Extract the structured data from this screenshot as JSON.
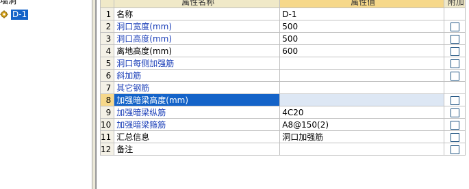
{
  "tree": {
    "root_label": "墙洞",
    "item_label": "D-1"
  },
  "grid": {
    "headers": {
      "name": "属性名称",
      "value": "属性值",
      "extra": "附加"
    },
    "rows": [
      {
        "n": "1",
        "name": "名称",
        "value": "D-1",
        "check": false,
        "blue": false
      },
      {
        "n": "2",
        "name": "洞口宽度(mm)",
        "value": "500",
        "check": true,
        "blue": true
      },
      {
        "n": "3",
        "name": "洞口高度(mm)",
        "value": "500",
        "check": true,
        "blue": true
      },
      {
        "n": "4",
        "name": "离地高度(mm)",
        "value": "600",
        "check": true,
        "blue": false
      },
      {
        "n": "5",
        "name": "洞口每侧加强筋",
        "value": "",
        "check": true,
        "blue": true
      },
      {
        "n": "6",
        "name": "斜加筋",
        "value": "",
        "check": true,
        "blue": true
      },
      {
        "n": "7",
        "name": "其它钢筋",
        "value": "",
        "check": false,
        "blue": true
      },
      {
        "n": "8",
        "name": "加强暗梁高度(mm)",
        "value": "",
        "check": true,
        "blue": true
      },
      {
        "n": "9",
        "name": "加强暗梁纵筋",
        "value": "4C20",
        "check": true,
        "blue": true
      },
      {
        "n": "10",
        "name": "加强暗梁箍筋",
        "value": "A8@150(2)",
        "check": true,
        "blue": true
      },
      {
        "n": "11",
        "name": "汇总信息",
        "value": "洞口加强筋",
        "check": true,
        "blue": false
      },
      {
        "n": "12",
        "name": "备注",
        "value": "",
        "check": true,
        "blue": false
      }
    ],
    "selected_row": "8"
  }
}
